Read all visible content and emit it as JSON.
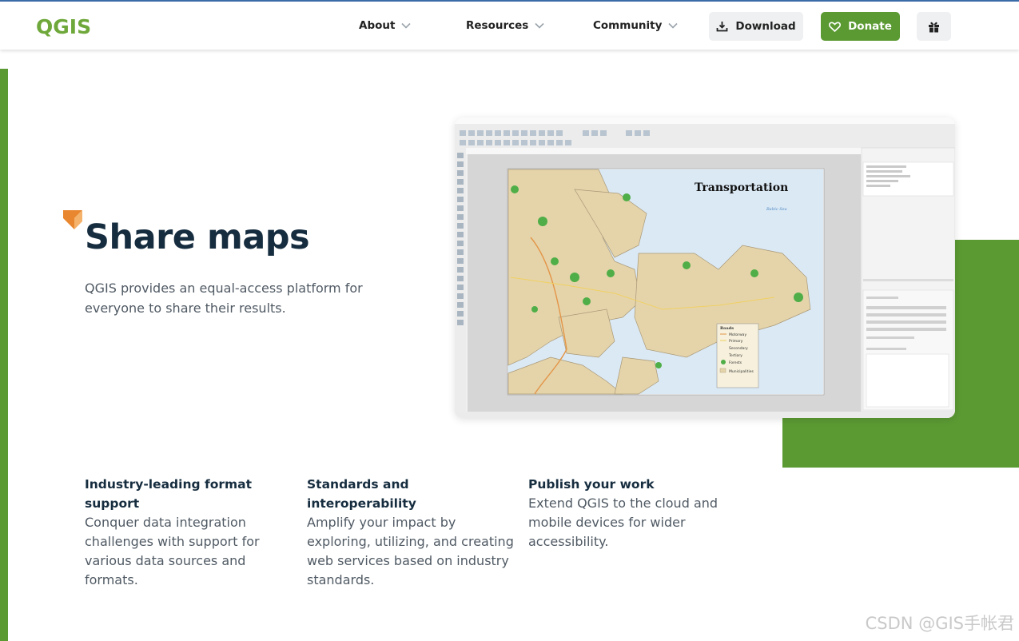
{
  "brand": {
    "logo_text": "QGIS",
    "accent_color": "#5b9a33",
    "logo_color": "#6fa83a",
    "accent_orange": "#e8872f"
  },
  "nav": {
    "items": [
      {
        "label": "About",
        "icon": "chevron-down-icon"
      },
      {
        "label": "Resources",
        "icon": "chevron-down-icon"
      },
      {
        "label": "Community",
        "icon": "chevron-down-icon"
      }
    ],
    "download_label": "Download",
    "donate_label": "Donate",
    "gift_icon": "gift-icon"
  },
  "hero": {
    "title": "Share maps",
    "subtitle": "QGIS provides an equal-access platform for everyone to share their results."
  },
  "screenshot": {
    "map_title": "Transportation",
    "sea_label": "Baltic Sea",
    "legend_title": "Roads",
    "legend_items": [
      "Motorway",
      "Primary",
      "Secondary",
      "Tertiary",
      "Forests",
      "Municipalities"
    ]
  },
  "features": [
    {
      "title": "Industry-leading format support",
      "desc": "Conquer data integration challenges with support for various data sources and formats."
    },
    {
      "title": "Standards and interoperability",
      "desc": "Amplify your impact by exploring, utilizing, and creating web services based on industry standards."
    },
    {
      "title": "Publish your work",
      "desc": "Extend QGIS to the cloud and mobile devices for wider accessibility."
    }
  ],
  "watermark": "CSDN @GIS手帐君"
}
